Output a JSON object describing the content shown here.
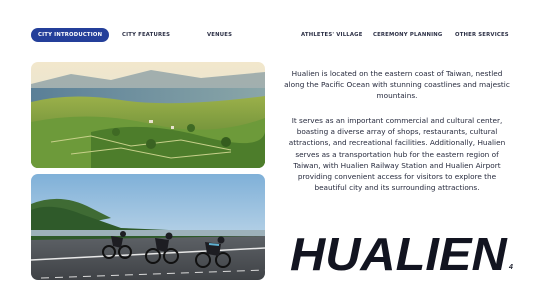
{
  "nav": {
    "items": [
      {
        "label": "CITY INTRODUCTION",
        "active": true
      },
      {
        "label": "CITY FEATURES",
        "active": false
      },
      {
        "label": "VENUES",
        "active": false
      },
      {
        "label": "ATHLETES' VILLAGE",
        "active": false
      },
      {
        "label": "CEREMONY PLANNING",
        "active": false
      },
      {
        "label": "OTHER SERVICES",
        "active": false
      }
    ]
  },
  "content": {
    "paragraph1": "Hualien is located on the eastern coast of Taiwan, nestled along the Pacific Ocean with stunning coastlines and majestic mountains.",
    "paragraph2": "It serves as an important commercial and cultural center, boasting a diverse array of shops, restaurants, cultural attractions, and recreational facilities. Additionally, Hualien serves as a transportation hub for the eastern region of Taiwan, with Hualien Railway Station and Hualien Airport providing convenient access for visitors to explore the beautiful city and its surrounding attractions.",
    "brand": "HUALIEN"
  },
  "page_number": "4",
  "colors": {
    "accent": "#243f9a",
    "text": "#262a3d"
  }
}
